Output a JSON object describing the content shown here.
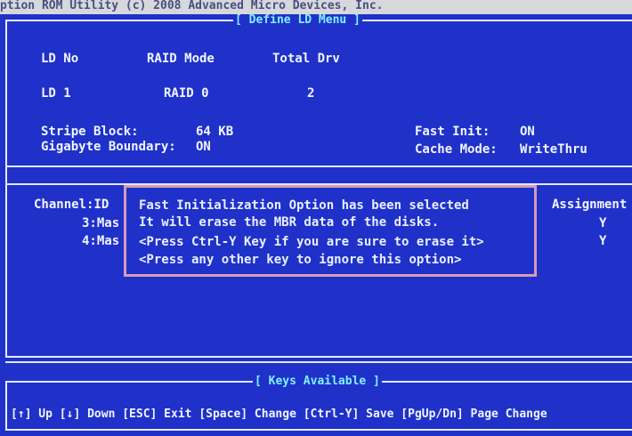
{
  "header_bar": "ption ROM Utility (c) 2008 Advanced Micro Devices, Inc.",
  "menu_title": "[ Define LD Menu ]",
  "columns": {
    "ld_no": "LD No",
    "raid_mode": "RAID Mode",
    "total_drv": "Total Drv"
  },
  "ld": {
    "ld_no": "LD  1",
    "raid_mode": "RAID 0",
    "total_drv": "2"
  },
  "settings": {
    "stripe_block_label": "Stripe Block:",
    "stripe_block_value": "64  KB",
    "gigabyte_boundary_label": "Gigabyte Boundary:",
    "gigabyte_boundary_value": "ON",
    "fast_init_label": "Fast Init:",
    "fast_init_value": "ON",
    "cache_mode_label": "Cache Mode:",
    "cache_mode_value": "WriteThru"
  },
  "channel_table": {
    "header_channel": "Channel:ID",
    "header_assignment": "Assignment",
    "rows": [
      {
        "channel": "3:Mas",
        "assignment": "Y"
      },
      {
        "channel": "4:Mas",
        "assignment": "Y"
      }
    ]
  },
  "dialog": {
    "line1": "Fast Initialization Option has been selected",
    "line2": "It will erase the MBR data of the disks.",
    "line3": "<Press Ctrl-Y Key if you are sure to erase it>",
    "line4": "<Press any other key to ignore this option>"
  },
  "keys_title": "[ Keys Available ]",
  "keys_line": "[↑] Up [↓] Down [ESC] Exit [Space] Change [Ctrl-Y] Save [PgUp/Dn] Page Change"
}
